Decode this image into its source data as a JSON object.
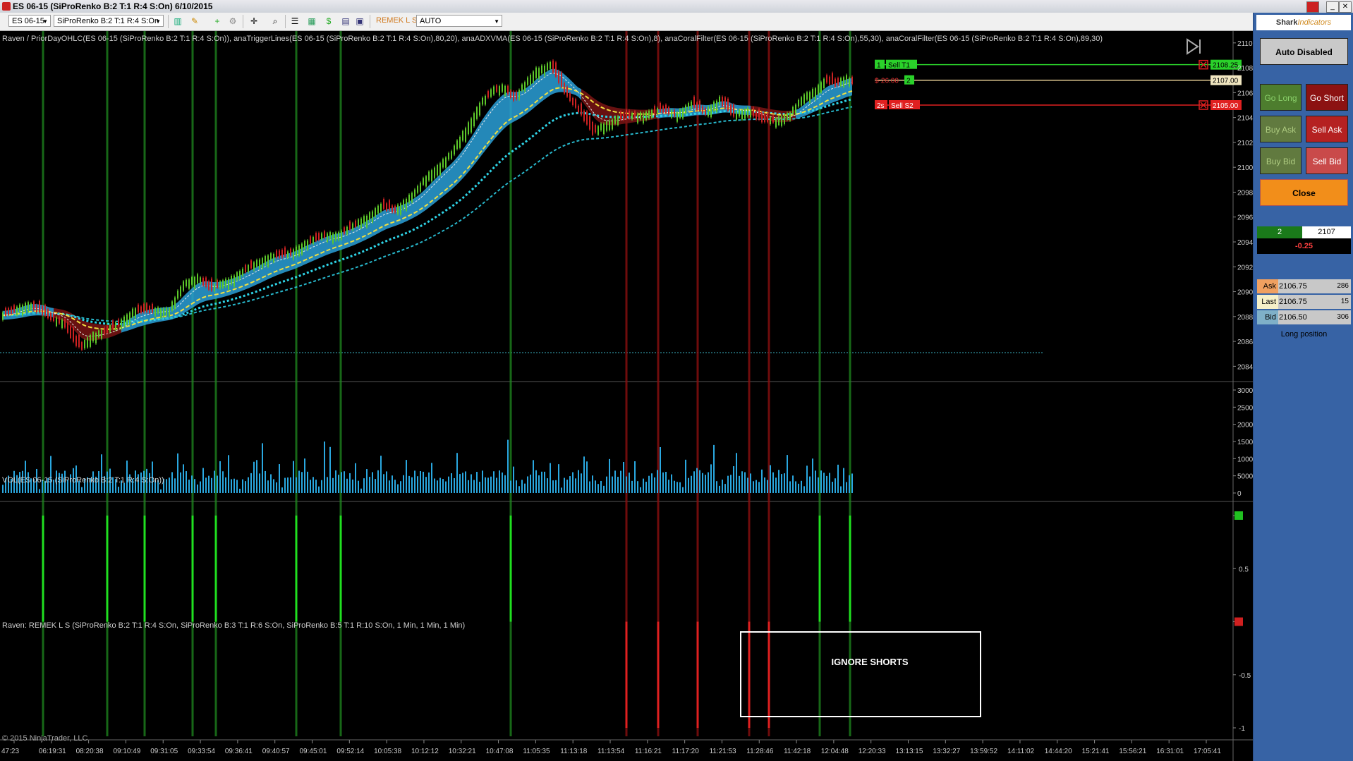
{
  "window": {
    "title": "ES 06-15 (SiProRenko B:2 T:1 R:4 S:On)  6/10/2015"
  },
  "toolbar": {
    "instrument": "ES 06-15",
    "bar_type": "SiProRenko B:2 T:1 R:4 S:On",
    "strategy_label": "REMEK L S",
    "atm_select": "AUTO"
  },
  "panels": {
    "price_title": "Raven / PriorDayOHLC(ES 06-15 (SiProRenko B:2 T:1 R:4 S:On)), anaTriggerLines(ES 06-15 (SiProRenko B:2 T:1 R:4 S:On),80,20), anaADXVMA(ES 06-15 (SiProRenko B:2 T:1 R:4 S:On),8), anaCoralFilter(ES 06-15 (SiProRenko B:2 T:1 R:4 S:On),55,30), anaCoralFilter(ES 06-15 (SiProRenko B:2 T:1 R:4 S:On),89,30)",
    "volume_title": "VOL(ES 06-15 (SiProRenko B:2 T:1 R:4 S:On))",
    "signal_title": "Raven: REMEK L S (SiProRenko B:2 T:1 R:4 S:On, SiProRenko B:3 T:1 R:6 S:On, SiProRenko B:5 T:1 R:10 S:On, 1 Min, 1 Min, 1 Min)",
    "copyright": "© 2015 NinjaTrader, LLC",
    "annotation": "IGNORE SHORTS"
  },
  "orders": {
    "target": {
      "qty": "1",
      "label": "Sell T1",
      "price": "2108.25"
    },
    "position": {
      "pnl": "$-26.00",
      "qty": "2",
      "price": "2107.00"
    },
    "stop": {
      "qty": "2s",
      "label": "Sell S2",
      "price": "2105.00"
    }
  },
  "side_panel": {
    "logo_a": "Shark",
    "logo_b": "Indicators",
    "auto_button": "Auto Disabled",
    "go_long": "Go Long",
    "go_short": "Go Short",
    "buy_ask": "Buy Ask",
    "sell_ask": "Sell Ask",
    "buy_bid": "Buy Bid",
    "sell_bid": "Sell Bid",
    "close": "Close",
    "qty": "2",
    "price": "2107",
    "pnl": "-0.25",
    "ask_label": "Ask",
    "ask_price": "2106.75",
    "ask_size": "286",
    "last_label": "Last",
    "last_price": "2106.75",
    "last_size": "15",
    "bid_label": "Bid",
    "bid_price": "2106.50",
    "bid_size": "306",
    "position_text": "Long position"
  },
  "colors": {
    "up_bar": "#5cc72a",
    "down_bar": "#cc2222",
    "cloud_bull": "#2aa0d8",
    "cloud_bear": "#7a1414",
    "long_signal": "#1f8a1f",
    "short_signal": "#8b1010",
    "cyan": "#2ed3e6",
    "yellow": "#f0e040"
  },
  "chart_data": {
    "type": "candlestick",
    "x_labels": [
      "47:23",
      "06:19:31",
      "08:20:38",
      "09:10:49",
      "09:31:05",
      "09:33:54",
      "09:36:41",
      "09:40:57",
      "09:45:01",
      "09:52:14",
      "10:05:38",
      "10:12:12",
      "10:32:21",
      "10:47:08",
      "11:05:35",
      "11:13:18",
      "11:13:54",
      "11:16:21",
      "11:17:20",
      "11:21:53",
      "11:28:46",
      "11:42:18",
      "12:04:48",
      "12:20:33",
      "13:13:15",
      "13:32:27",
      "13:59:52",
      "14:11:02",
      "14:44:20",
      "15:21:41",
      "15:56:21",
      "16:31:01",
      "17:05:41"
    ],
    "price_ticks": [
      "2110.00",
      "2108.00",
      "2106.00",
      "2104.00",
      "2102.00",
      "2100.00",
      "2098.00",
      "2096.00",
      "2094.00",
      "2092.00",
      "2090.00",
      "2088.00",
      "2086.00",
      "2084.00"
    ],
    "price_range": [
      2083.0,
      2110.5
    ],
    "volume_ticks": [
      "30000",
      "25000",
      "20000",
      "15000",
      "10000",
      "5000",
      "0"
    ],
    "volume_range": [
      0,
      30000
    ],
    "signal_ticks": [
      "1",
      "0.5",
      "0",
      "-0.5",
      "-1"
    ],
    "signal_range": [
      -1,
      1
    ],
    "path_anchors": [
      [
        0,
        2088.0
      ],
      [
        40,
        2089.0
      ],
      [
        55,
        2088.5
      ],
      [
        70,
        2088.0
      ],
      [
        90,
        2087.6
      ],
      [
        105,
        2086.0
      ],
      [
        115,
        2085.5
      ],
      [
        130,
        2086.5
      ],
      [
        150,
        2086.8
      ],
      [
        170,
        2087.5
      ],
      [
        190,
        2088.5
      ],
      [
        210,
        2088.5
      ],
      [
        240,
        2088.5
      ],
      [
        260,
        2090.5
      ],
      [
        280,
        2091.2
      ],
      [
        300,
        2090.2
      ],
      [
        320,
        2090.8
      ],
      [
        345,
        2091.6
      ],
      [
        380,
        2092.8
      ],
      [
        410,
        2093.0
      ],
      [
        430,
        2093.8
      ],
      [
        460,
        2094.5
      ],
      [
        480,
        2094.6
      ],
      [
        500,
        2095.2
      ],
      [
        540,
        2096.8
      ],
      [
        560,
        2096.6
      ],
      [
        590,
        2098.0
      ],
      [
        610,
        2099.5
      ],
      [
        640,
        2101.0
      ],
      [
        660,
        2103.0
      ],
      [
        680,
        2105.0
      ],
      [
        700,
        2106.2
      ],
      [
        715,
        2106.5
      ],
      [
        730,
        2105.5
      ],
      [
        760,
        2107.8
      ],
      [
        780,
        2108.2
      ],
      [
        800,
        2106.2
      ],
      [
        820,
        2104.8
      ],
      [
        840,
        2102.8
      ],
      [
        860,
        2103.5
      ],
      [
        880,
        2104.0
      ],
      [
        910,
        2104.2
      ],
      [
        940,
        2104.6
      ],
      [
        960,
        2104.3
      ],
      [
        980,
        2105.0
      ],
      [
        1000,
        2104.5
      ],
      [
        1020,
        2105.4
      ],
      [
        1040,
        2104.2
      ],
      [
        1060,
        2104.6
      ],
      [
        1080,
        2103.8
      ],
      [
        1100,
        2103.8
      ],
      [
        1120,
        2104.2
      ],
      [
        1140,
        2105.6
      ],
      [
        1160,
        2106.4
      ],
      [
        1170,
        2107.0
      ],
      [
        1185,
        2106.7
      ],
      [
        1200,
        2107.2
      ],
      [
        1210,
        2106.9
      ]
    ],
    "long_signals": [
      61,
      152,
      205,
      273,
      306,
      420,
      483,
      724,
      1162,
      1205
    ],
    "short_signals": [
      888,
      933,
      989,
      1062,
      1090
    ],
    "volume_spikes": [
      [
        598,
        28500
      ],
      [
        1186,
        22000
      ],
      [
        720,
        15500
      ],
      [
        460,
        15000
      ],
      [
        373,
        14500
      ],
      [
        862,
        15000
      ],
      [
        1012,
        14000
      ],
      [
        918,
        13000
      ],
      [
        862,
        15000
      ]
    ]
  }
}
